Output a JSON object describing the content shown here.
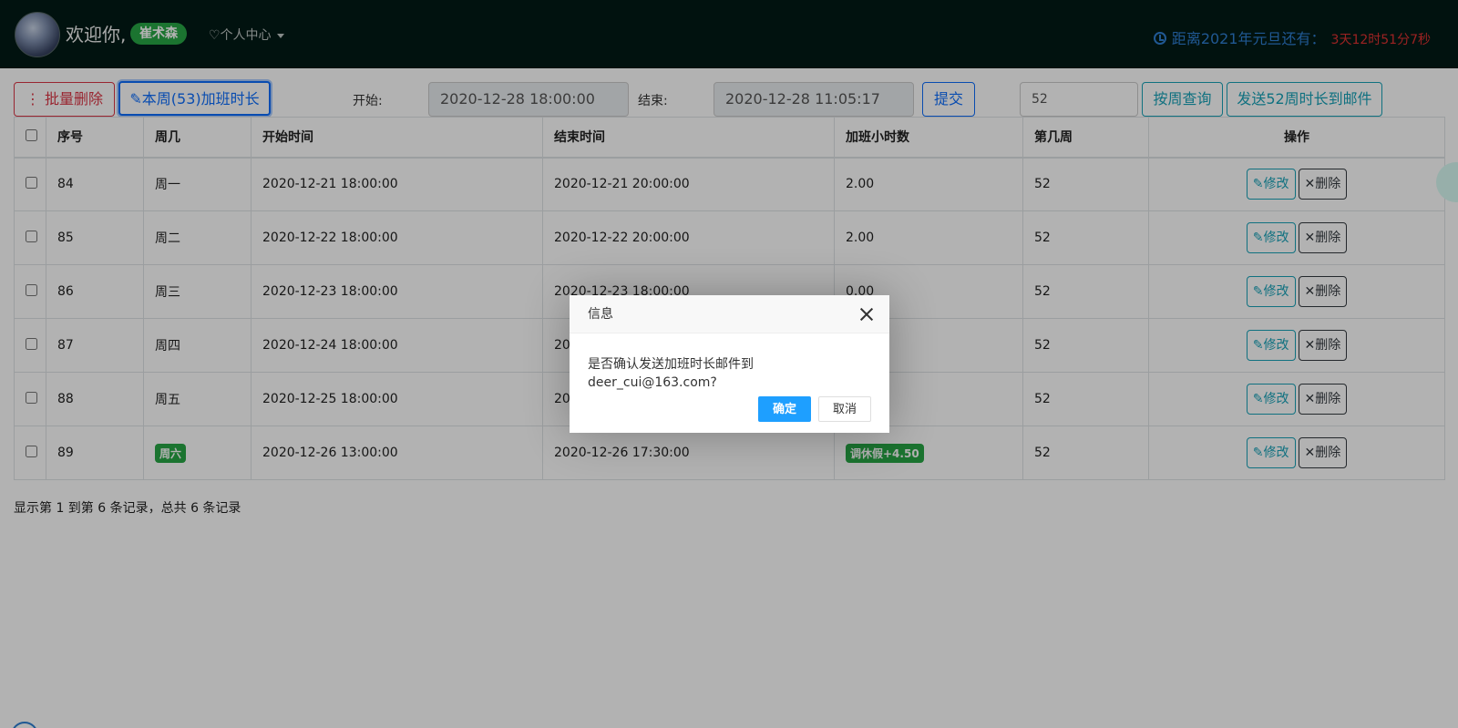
{
  "header": {
    "welcome": "欢迎你,",
    "username": "崔术森",
    "user_center": "个人中心",
    "countdown_label": "距离2021年元旦还有：",
    "countdown_value": "3天12时51分7秒"
  },
  "toolbar": {
    "batch_delete": "批量删除",
    "week_hours": "本周(53)加班时长",
    "start_label": "开始:",
    "start_value": "2020-12-28 18:00:00",
    "end_label": "结束:",
    "end_value": "2020-12-28 11:05:17",
    "submit": "提交",
    "week_value": "52",
    "query_week": "按周查询",
    "send_email": "发送52周时长到邮件"
  },
  "table": {
    "headers": [
      "序号",
      "周几",
      "开始时间",
      "结束时间",
      "加班小时数",
      "第几周",
      "操作"
    ],
    "edit_label": "修改",
    "delete_label": "删除",
    "rows": [
      {
        "id": "84",
        "day": "周一",
        "start": "2020-12-21 18:00:00",
        "end": "2020-12-21 20:00:00",
        "hours": "2.00",
        "week": "52"
      },
      {
        "id": "85",
        "day": "周二",
        "start": "2020-12-22 18:00:00",
        "end": "2020-12-22 20:00:00",
        "hours": "2.00",
        "week": "52"
      },
      {
        "id": "86",
        "day": "周三",
        "start": "2020-12-23 18:00:00",
        "end": "2020-12-23 18:00:00",
        "hours": "0.00",
        "week": "52"
      },
      {
        "id": "87",
        "day": "周四",
        "start": "2020-12-24 18:00:00",
        "end": "20",
        "hours": "",
        "week": "52"
      },
      {
        "id": "88",
        "day": "周五",
        "start": "2020-12-25 18:00:00",
        "end": "20",
        "hours": "",
        "week": "52"
      },
      {
        "id": "89",
        "day": "周六",
        "start": "2020-12-26 13:00:00",
        "end": "2020-12-26 17:30:00",
        "hours": "调休假+4.50",
        "week": "52"
      }
    ]
  },
  "footer": {
    "info": "显示第 1 到第 6 条记录，总共 6 条记录"
  },
  "dialog": {
    "title": "信息",
    "message": "是否确认发送加班时长邮件到deer_cui@163.com?",
    "ok": "确定",
    "cancel": "取消"
  }
}
